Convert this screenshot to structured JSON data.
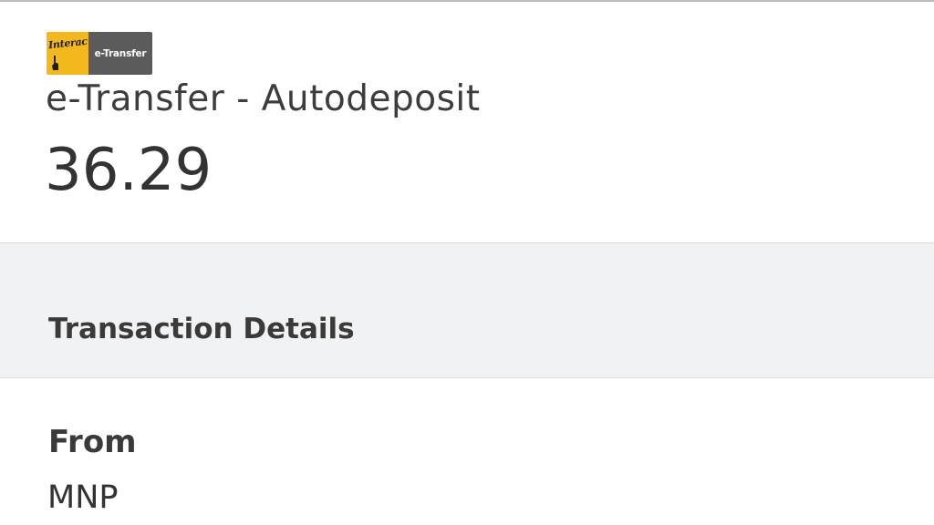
{
  "logo": {
    "brand_text": "Interac",
    "product_text": "e-Transfer",
    "brand_color": "#f2b81d",
    "product_bg_color": "#5b5b5b",
    "icon": "interac-hand-icon"
  },
  "transaction": {
    "title": "e-Transfer - Autodeposit",
    "amount": "36.29"
  },
  "details_section": {
    "heading": "Transaction Details",
    "background_color": "#f1f2f4"
  },
  "details": [
    {
      "label": "From",
      "value": "MNP"
    }
  ]
}
